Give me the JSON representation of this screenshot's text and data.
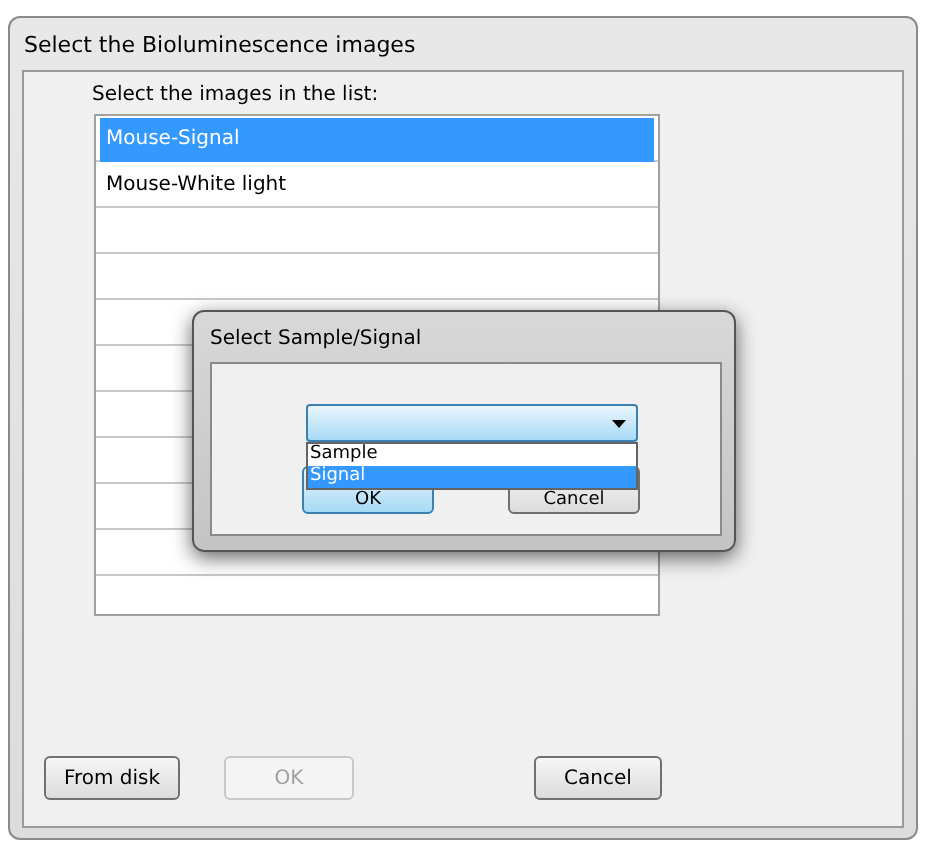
{
  "window": {
    "title": "Select the Bioluminescence images"
  },
  "list_label": "Select the images in the list:",
  "images": [
    {
      "label": "Mouse-Signal",
      "selected": true
    },
    {
      "label": "Mouse-White light",
      "selected": false
    }
  ],
  "buttons": [
    {
      "label": "From disk",
      "disabled": false
    },
    {
      "label": "OK",
      "disabled": true
    },
    {
      "label": "Cancel",
      "disabled": false
    }
  ],
  "dialog": {
    "title": "Select Sample/Signal",
    "dropdown": {
      "expanded": true,
      "options": [
        {
          "label": "Sample",
          "selected": false
        },
        {
          "label": "Signal",
          "selected": true
        }
      ]
    },
    "buttons": [
      {
        "label": "OK",
        "default": true
      },
      {
        "label": "Cancel",
        "default": false
      }
    ]
  }
}
